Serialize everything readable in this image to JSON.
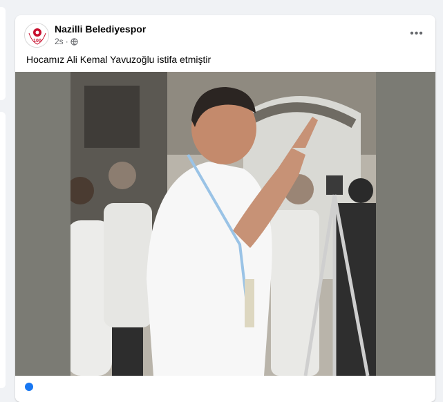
{
  "post": {
    "author": "Nazilli Belediyespor",
    "time": "2s",
    "caption": "Hocamız Ali Kemal Yavuzoğlu istifa etmiştir",
    "avatar": {
      "badge_text": "100",
      "icon": "club-logo-icon"
    },
    "privacy_icon": "globe-icon",
    "more_icon": "more-options-icon",
    "photo": {
      "description_icon": "coach-photo",
      "background_color": "#7b7b74"
    }
  },
  "colors": {
    "page_bg": "#f0f2f5",
    "card_bg": "#ffffff",
    "text_primary": "#050505",
    "text_secondary": "#65676b",
    "accent": "#1877f2",
    "logo_red": "#c8102e"
  }
}
